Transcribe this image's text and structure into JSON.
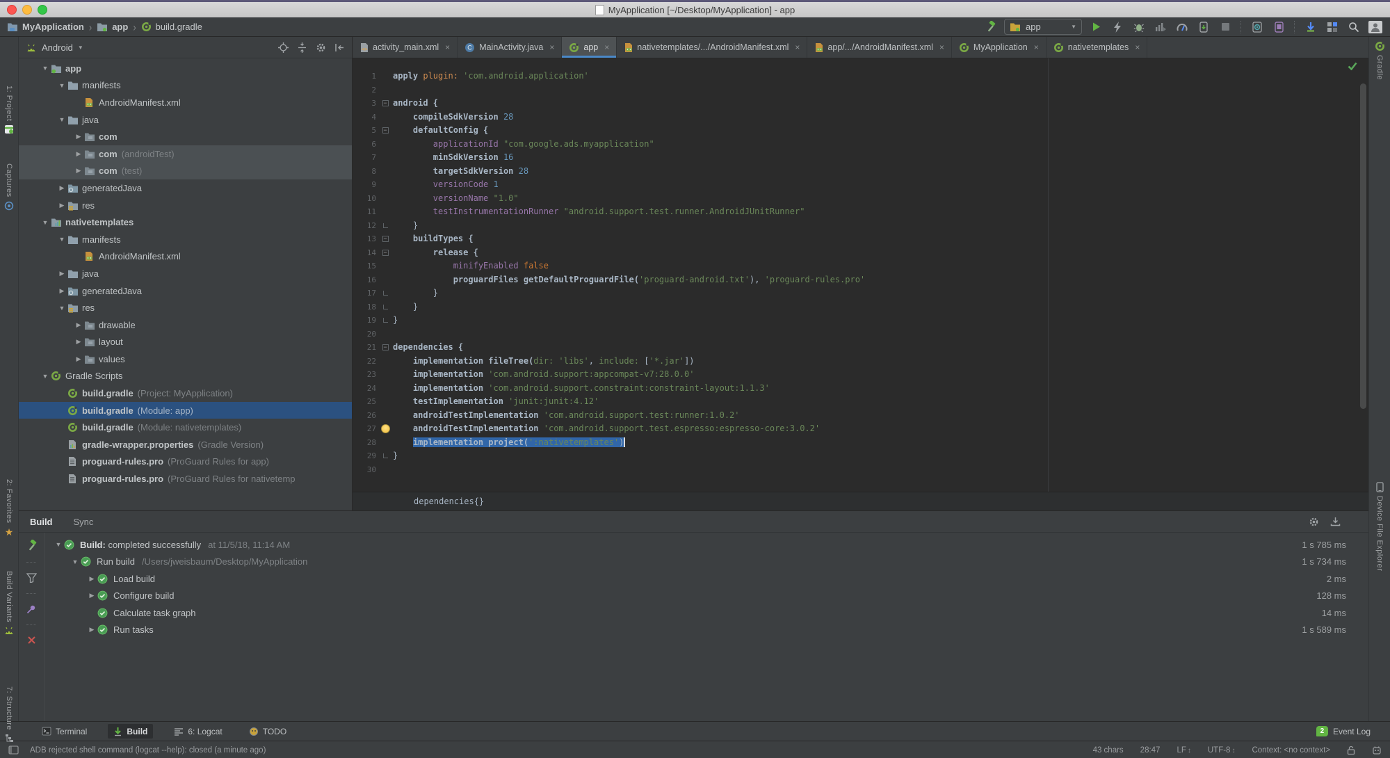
{
  "window": {
    "title": "MyApplication [~/Desktop/MyApplication] - app"
  },
  "breadcrumbs": {
    "items": [
      "MyApplication",
      "app",
      "build.gradle"
    ]
  },
  "toolbar": {
    "run_config": "app",
    "icons": [
      "build-hammer-icon",
      "run-icon",
      "apply-changes-icon",
      "debug-icon",
      "profile-icon",
      "profiler-icon",
      "attach-debugger-icon",
      "stop-icon",
      "avd-manager-icon",
      "sdk-manager-icon",
      "sync-icon",
      "project-structure-icon",
      "search-icon",
      "user-avatar-icon"
    ]
  },
  "project_panel": {
    "view": "Android",
    "header_icons": [
      "locate-icon",
      "collapse-all-icon",
      "gear-icon",
      "hide-panel-icon"
    ],
    "tree": [
      {
        "depth": 0,
        "arrow": "down",
        "icon": "app-module",
        "label": "app",
        "secondary": "",
        "hl": "",
        "bold": true
      },
      {
        "depth": 1,
        "arrow": "down",
        "icon": "folder",
        "label": "manifests",
        "secondary": "",
        "hl": "",
        "bold": false
      },
      {
        "depth": 2,
        "arrow": "none",
        "icon": "manifest",
        "label": "AndroidManifest.xml",
        "secondary": "",
        "hl": "",
        "bold": false
      },
      {
        "depth": 1,
        "arrow": "down",
        "icon": "folder",
        "label": "java",
        "secondary": "",
        "hl": "",
        "bold": false
      },
      {
        "depth": 2,
        "arrow": "right",
        "icon": "package",
        "label": "com",
        "secondary": "",
        "hl": "",
        "bold": true
      },
      {
        "depth": 2,
        "arrow": "right",
        "icon": "package",
        "label": "com",
        "secondary": "(androidTest)",
        "hl": "gray",
        "bold": true
      },
      {
        "depth": 2,
        "arrow": "right",
        "icon": "package",
        "label": "com",
        "secondary": "(test)",
        "hl": "gray",
        "bold": true
      },
      {
        "depth": 1,
        "arrow": "right",
        "icon": "gen-folder",
        "label": "generatedJava",
        "secondary": "",
        "hl": "",
        "bold": false
      },
      {
        "depth": 1,
        "arrow": "right",
        "icon": "res-folder",
        "label": "res",
        "secondary": "",
        "hl": "",
        "bold": false
      },
      {
        "depth": 0,
        "arrow": "down",
        "icon": "module",
        "label": "nativetemplates",
        "secondary": "",
        "hl": "",
        "bold": true
      },
      {
        "depth": 1,
        "arrow": "down",
        "icon": "folder",
        "label": "manifests",
        "secondary": "",
        "hl": "",
        "bold": false
      },
      {
        "depth": 2,
        "arrow": "none",
        "icon": "manifest",
        "label": "AndroidManifest.xml",
        "secondary": "",
        "hl": "",
        "bold": false
      },
      {
        "depth": 1,
        "arrow": "right",
        "icon": "folder",
        "label": "java",
        "secondary": "",
        "hl": "",
        "bold": false
      },
      {
        "depth": 1,
        "arrow": "right",
        "icon": "gen-folder",
        "label": "generatedJava",
        "secondary": "",
        "hl": "",
        "bold": false
      },
      {
        "depth": 1,
        "arrow": "down",
        "icon": "res-folder",
        "label": "res",
        "secondary": "",
        "hl": "",
        "bold": false
      },
      {
        "depth": 2,
        "arrow": "right",
        "icon": "package",
        "label": "drawable",
        "secondary": "",
        "hl": "",
        "bold": false
      },
      {
        "depth": 2,
        "arrow": "right",
        "icon": "package",
        "label": "layout",
        "secondary": "",
        "hl": "",
        "bold": false
      },
      {
        "depth": 2,
        "arrow": "right",
        "icon": "package",
        "label": "values",
        "secondary": "",
        "hl": "",
        "bold": false
      },
      {
        "depth": 0,
        "arrow": "down",
        "icon": "gradle",
        "label": "Gradle Scripts",
        "secondary": "",
        "hl": "",
        "bold": false
      },
      {
        "depth": 1,
        "arrow": "none",
        "icon": "gradle",
        "label": "build.gradle",
        "secondary": "(Project: MyApplication)",
        "hl": "",
        "bold": true
      },
      {
        "depth": 1,
        "arrow": "none",
        "icon": "gradle",
        "label": "build.gradle",
        "secondary": "(Module: app)",
        "hl": "blue",
        "bold": true
      },
      {
        "depth": 1,
        "arrow": "none",
        "icon": "gradle",
        "label": "build.gradle",
        "secondary": "(Module: nativetemplates)",
        "hl": "",
        "bold": true
      },
      {
        "depth": 1,
        "arrow": "none",
        "icon": "wrapper",
        "label": "gradle-wrapper.properties",
        "secondary": "(Gradle Version)",
        "hl": "",
        "bold": true
      },
      {
        "depth": 1,
        "arrow": "none",
        "icon": "proguard",
        "label": "proguard-rules.pro",
        "secondary": "(ProGuard Rules for app)",
        "hl": "",
        "bold": true
      },
      {
        "depth": 1,
        "arrow": "none",
        "icon": "proguard",
        "label": "proguard-rules.pro",
        "secondary": "(ProGuard Rules for nativetemp",
        "hl": "",
        "bold": true
      }
    ]
  },
  "editor": {
    "tabs": [
      {
        "label": "activity_main.xml",
        "icon": "xml",
        "selected": false
      },
      {
        "label": "MainActivity.java",
        "icon": "java",
        "selected": false
      },
      {
        "label": "app",
        "icon": "gradle",
        "selected": true
      },
      {
        "label": "nativetemplates/.../AndroidManifest.xml",
        "icon": "manifest",
        "selected": false
      },
      {
        "label": "app/.../AndroidManifest.xml",
        "icon": "manifest",
        "selected": false
      },
      {
        "label": "MyApplication",
        "icon": "gradle",
        "selected": false
      },
      {
        "label": "nativetemplates",
        "icon": "gradle",
        "selected": false
      }
    ],
    "context_line": "dependencies{}",
    "lines": [
      {
        "n": 1,
        "f": "",
        "seg": [
          [
            "apply ",
            "b"
          ],
          [
            "plugin: ",
            "na"
          ],
          [
            "'com.android.application'",
            "s"
          ]
        ]
      },
      {
        "n": 2,
        "f": "",
        "seg": []
      },
      {
        "n": 3,
        "f": "open",
        "seg": [
          [
            "android {",
            "b"
          ]
        ]
      },
      {
        "n": 4,
        "f": "",
        "seg": [
          [
            "    compileSdkVersion ",
            "b"
          ],
          [
            "28",
            "n"
          ]
        ]
      },
      {
        "n": 5,
        "f": "open",
        "seg": [
          [
            "    defaultConfig {",
            "b"
          ]
        ]
      },
      {
        "n": 6,
        "f": "",
        "seg": [
          [
            "        applicationId ",
            "p"
          ],
          [
            "\"com.google.ads.myapplication\"",
            "s"
          ]
        ]
      },
      {
        "n": 7,
        "f": "",
        "seg": [
          [
            "        minSdkVersion ",
            "b"
          ],
          [
            "16",
            "n"
          ]
        ]
      },
      {
        "n": 8,
        "f": "",
        "seg": [
          [
            "        targetSdkVersion ",
            "b"
          ],
          [
            "28",
            "n"
          ]
        ]
      },
      {
        "n": 9,
        "f": "",
        "seg": [
          [
            "        versionCode ",
            "p"
          ],
          [
            "1",
            "n"
          ]
        ]
      },
      {
        "n": 10,
        "f": "",
        "seg": [
          [
            "        versionName ",
            "p"
          ],
          [
            "\"1.0\"",
            "s"
          ]
        ]
      },
      {
        "n": 11,
        "f": "",
        "seg": [
          [
            "        testInstrumentationRunner ",
            "p"
          ],
          [
            "\"android.support.test.runner.AndroidJUnitRunner\"",
            "s"
          ]
        ]
      },
      {
        "n": 12,
        "f": "close",
        "seg": [
          [
            "    }",
            "d"
          ]
        ]
      },
      {
        "n": 13,
        "f": "open",
        "seg": [
          [
            "    buildTypes {",
            "b"
          ]
        ]
      },
      {
        "n": 14,
        "f": "open",
        "seg": [
          [
            "        release {",
            "b"
          ]
        ]
      },
      {
        "n": 15,
        "f": "",
        "seg": [
          [
            "            minifyEnabled ",
            "p"
          ],
          [
            "false",
            "o"
          ]
        ]
      },
      {
        "n": 16,
        "f": "",
        "seg": [
          [
            "            proguardFiles getDefaultProguardFile(",
            "b"
          ],
          [
            "'proguard-android.txt'",
            "s"
          ],
          [
            "), ",
            "d"
          ],
          [
            "'proguard-rules.pro'",
            "s"
          ]
        ]
      },
      {
        "n": 17,
        "f": "close",
        "seg": [
          [
            "        }",
            "d"
          ]
        ]
      },
      {
        "n": 18,
        "f": "close",
        "seg": [
          [
            "    }",
            "d"
          ]
        ]
      },
      {
        "n": 19,
        "f": "close",
        "seg": [
          [
            "}",
            "d"
          ]
        ]
      },
      {
        "n": 20,
        "f": "",
        "seg": []
      },
      {
        "n": 21,
        "f": "open",
        "seg": [
          [
            "dependencies {",
            "b"
          ]
        ]
      },
      {
        "n": 22,
        "f": "",
        "seg": [
          [
            "    implementation fileTree(",
            "b"
          ],
          [
            "dir: ",
            "g"
          ],
          [
            "'libs'",
            "s"
          ],
          [
            ", ",
            "d"
          ],
          [
            "include: ",
            "g"
          ],
          [
            "[",
            "d"
          ],
          [
            "'*.jar'",
            "s"
          ],
          [
            "])",
            "d"
          ]
        ]
      },
      {
        "n": 23,
        "f": "",
        "seg": [
          [
            "    implementation ",
            "b"
          ],
          [
            "'com.android.support:appcompat-v7:28.0.0'",
            "s"
          ]
        ]
      },
      {
        "n": 24,
        "f": "",
        "seg": [
          [
            "    implementation ",
            "b"
          ],
          [
            "'com.android.support.constraint:constraint-layout:1.1.3'",
            "s"
          ]
        ]
      },
      {
        "n": 25,
        "f": "",
        "seg": [
          [
            "    testImplementation ",
            "b"
          ],
          [
            "'junit:junit:4.12'",
            "s"
          ]
        ]
      },
      {
        "n": 26,
        "f": "",
        "seg": [
          [
            "    androidTestImplementation ",
            "b"
          ],
          [
            "'com.android.support.test:runner:1.0.2'",
            "s"
          ]
        ]
      },
      {
        "n": 27,
        "f": "",
        "bulb": true,
        "seg": [
          [
            "    androidTestImplementation ",
            "b"
          ],
          [
            "'com.android.support.test.espresso:espresso-core:3.0.2'",
            "s"
          ]
        ]
      },
      {
        "n": 28,
        "f": "",
        "sel": true,
        "pre": "    ",
        "seg": [
          [
            "implementation project(",
            "b"
          ],
          [
            "':nativetemplates'",
            "s"
          ],
          [
            ")",
            "d"
          ]
        ]
      },
      {
        "n": 29,
        "f": "close",
        "seg": [
          [
            "}",
            "d"
          ]
        ]
      },
      {
        "n": 30,
        "f": "",
        "seg": []
      }
    ]
  },
  "build_panel": {
    "tabs": [
      {
        "label": "Build",
        "selected": true
      },
      {
        "label": "Sync",
        "selected": false
      }
    ],
    "toolbar_icons": [
      "build-hammer-icon",
      "filter-icon",
      "pin-icon",
      "close-red-icon"
    ],
    "header_icons": [
      "gear-icon",
      "settings-dock-icon"
    ],
    "rows": [
      {
        "depth": 0,
        "arrow": "down",
        "label_bold": "Build:",
        "label": " completed successfully",
        "secondary": "at 11/5/18, 11:14 AM",
        "duration": "1 s 785 ms"
      },
      {
        "depth": 1,
        "arrow": "down",
        "label_bold": "",
        "label": "Run build",
        "secondary": "/Users/jweisbaum/Desktop/MyApplication",
        "duration": "1 s 734 ms"
      },
      {
        "depth": 2,
        "arrow": "right",
        "label_bold": "",
        "label": "Load build",
        "secondary": "",
        "duration": "2 ms"
      },
      {
        "depth": 2,
        "arrow": "right",
        "label_bold": "",
        "label": "Configure build",
        "secondary": "",
        "duration": "128 ms"
      },
      {
        "depth": 2,
        "arrow": "none",
        "label_bold": "",
        "label": "Calculate task graph",
        "secondary": "",
        "duration": "14 ms"
      },
      {
        "depth": 2,
        "arrow": "right",
        "label_bold": "",
        "label": "Run tasks",
        "secondary": "",
        "duration": "1 s 589 ms"
      }
    ]
  },
  "tool_buttons": {
    "left_top": [
      {
        "label": "1: Project",
        "icon": "project"
      },
      {
        "label": "Captures",
        "icon": "captures"
      }
    ],
    "left_bottom": [
      {
        "label": "2: Favorites",
        "icon": "star"
      },
      {
        "label": "Build Variants",
        "icon": "variants"
      },
      {
        "label": "7: Structure",
        "icon": "structure"
      }
    ],
    "right_top": [
      {
        "label": "Gradle",
        "icon": "gradle"
      }
    ],
    "right_bottom": [
      {
        "label": "Device File Explorer",
        "icon": "device"
      }
    ],
    "bottom": [
      {
        "label": "Terminal",
        "icon": "terminal",
        "selected": false
      },
      {
        "label": "Build",
        "icon": "build",
        "selected": true
      },
      {
        "label": "6: Logcat",
        "icon": "logcat",
        "selected": false
      },
      {
        "label": "TODO",
        "icon": "todo",
        "selected": false
      }
    ],
    "event_log": {
      "count": "2",
      "label": "Event Log"
    }
  },
  "status_bar": {
    "message": "ADB rejected shell command (logcat --help): closed (a minute ago)",
    "chars": "43 chars",
    "caret": "28:47",
    "line_ending": "LF",
    "encoding": "UTF-8",
    "context": "Context: <no context>"
  },
  "colors": {
    "accent_green": "#62b543",
    "selection_blue": "#3166a8",
    "tree_selection": "#2b5180",
    "string_green": "#6a8759",
    "number_blue": "#6897bb"
  }
}
